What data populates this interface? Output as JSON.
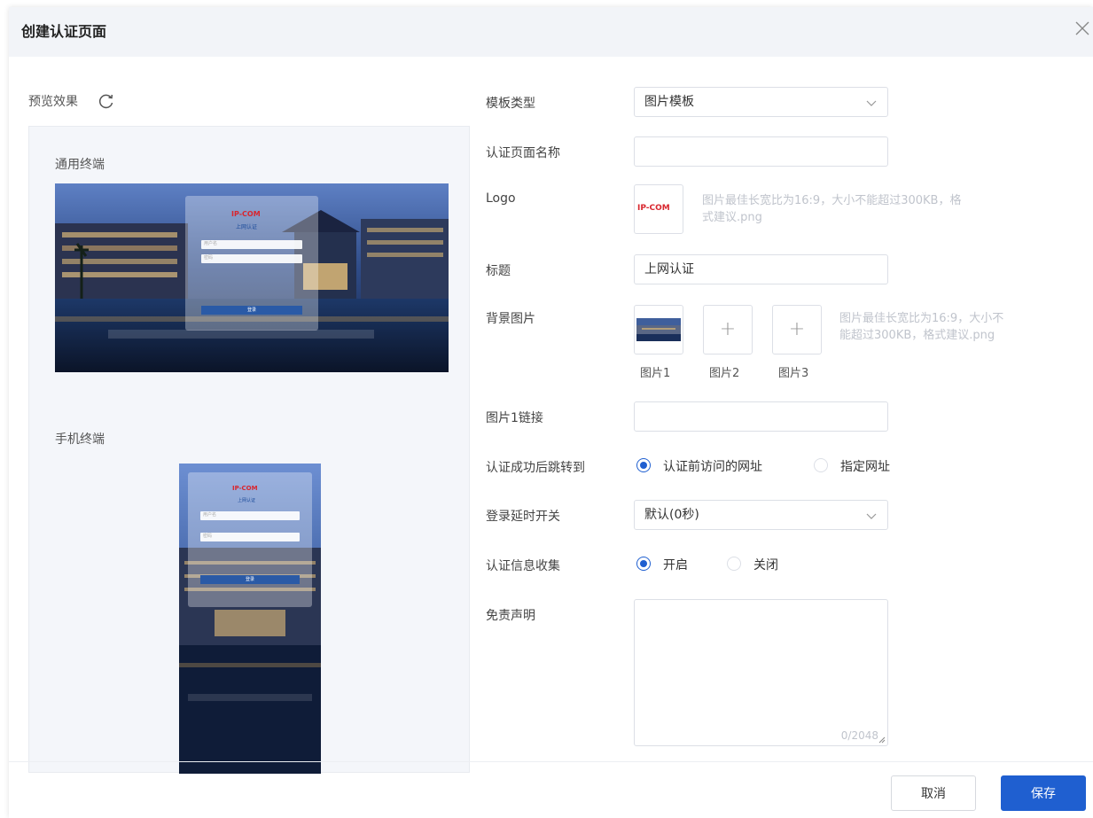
{
  "dialog": {
    "title": "创建认证页面"
  },
  "preview": {
    "label": "预览效果",
    "pc_label": "通用终端",
    "mobile_label": "手机终端",
    "card": {
      "logo": "IP-COM",
      "subtitle": "上网认证",
      "user_placeholder": "用户名",
      "pass_placeholder": "密码",
      "button": "登录"
    }
  },
  "form": {
    "template_type": {
      "label": "模板类型",
      "value": "图片模板"
    },
    "page_name": {
      "label": "认证页面名称",
      "value": ""
    },
    "logo": {
      "label": "Logo",
      "logo_text": "IP-COM",
      "hint": "图片最佳长宽比为16:9，大小不能超过300KB，格式建议.png"
    },
    "title": {
      "label": "标题",
      "value": "上网认证"
    },
    "background": {
      "label": "背景图片",
      "slots": [
        "图片1",
        "图片2",
        "图片3"
      ],
      "hint": "图片最佳长宽比为16:9，大小不能超过300KB，格式建议.png"
    },
    "image_link": {
      "label": "图片1链接",
      "value": ""
    },
    "redirect": {
      "label": "认证成功后跳转到",
      "options": [
        "认证前访问的网址",
        "指定网址"
      ],
      "selected": "认证前访问的网址"
    },
    "login_delay": {
      "label": "登录延时开关",
      "value": "默认(0秒)"
    },
    "info_collect": {
      "label": "认证信息收集",
      "options": [
        "开启",
        "关闭"
      ],
      "selected": "开启"
    },
    "disclaimer": {
      "label": "免责声明",
      "counter": "0/2048"
    }
  },
  "footer": {
    "cancel": "取消",
    "save": "保存"
  },
  "colors": {
    "primary": "#1f5fd0",
    "logo_red": "#d8262e",
    "header_bg": "#f2f4f8"
  }
}
